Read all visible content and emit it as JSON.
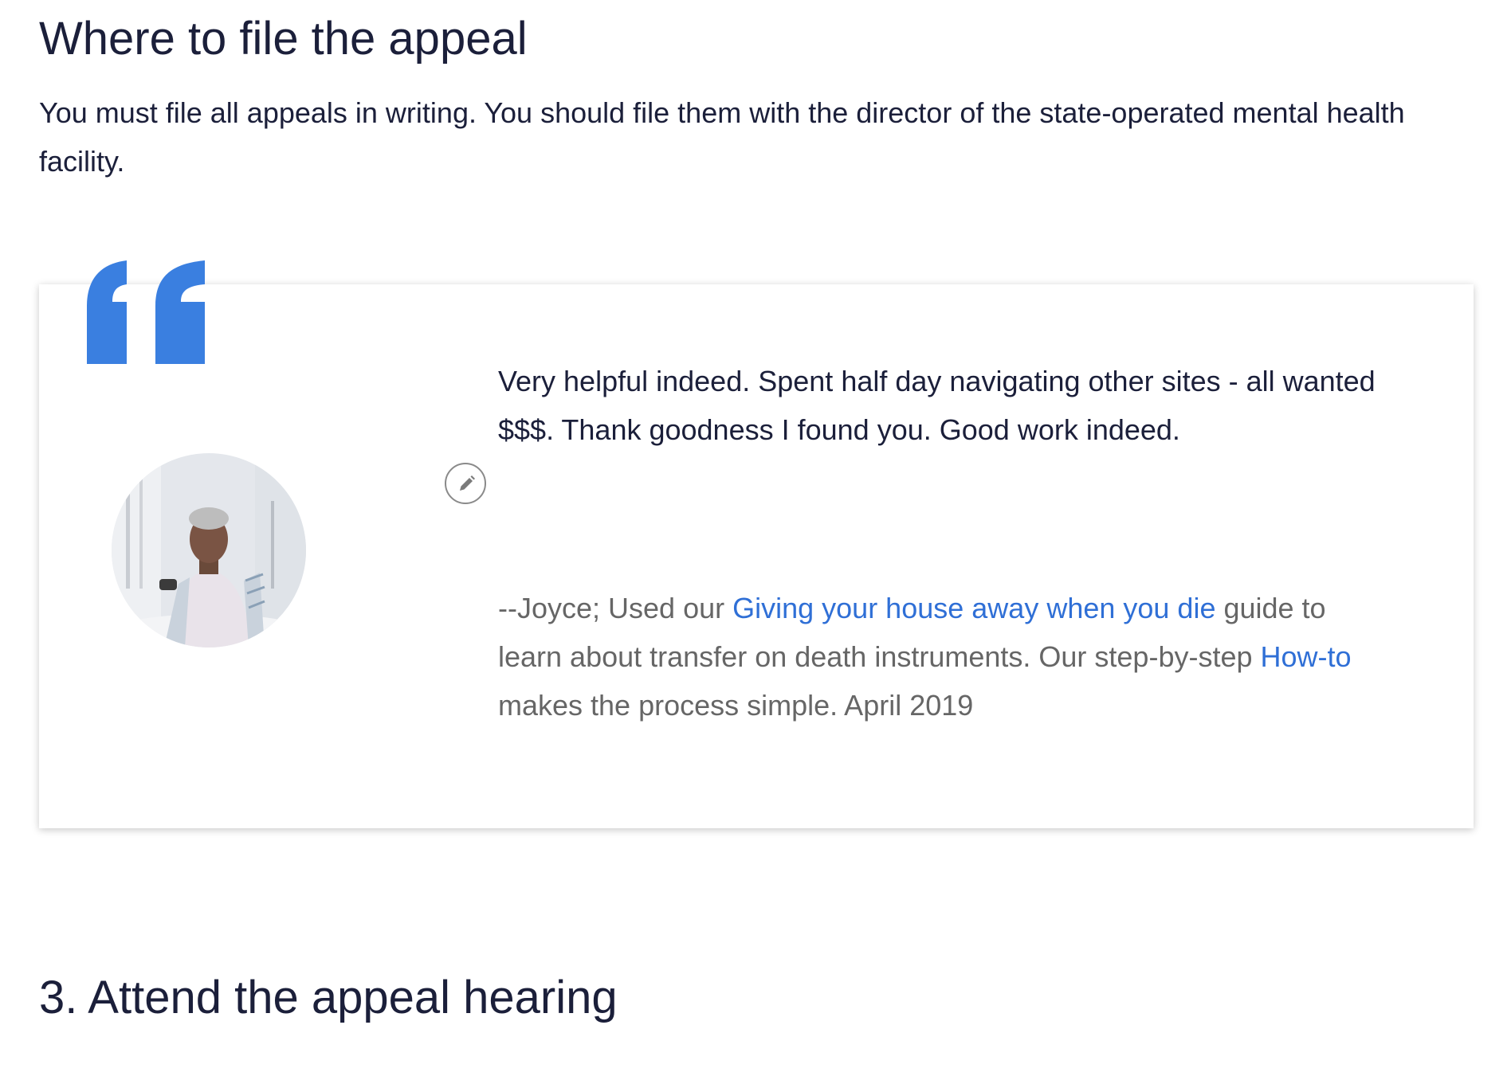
{
  "section": {
    "heading": "Where to file the appeal",
    "paragraph": "You must file all appeals in writing. You should file them with the director of the state-operated mental health facility."
  },
  "testimonial": {
    "quote_icon": "quote-icon",
    "edit_icon": "pencil-icon",
    "accent_color": "#3a7fe0",
    "quote": "Very helpful indeed. Spent half day navigating other sites - all wanted $$$. Thank goodness I found you. Good work indeed.",
    "attribution": {
      "prefix": "--Joyce; Used our ",
      "guide_link": "Giving your house away when you die",
      "middle": " guide to learn about transfer on death instruments. Our step-by-step ",
      "howto_link": "How-to",
      "suffix": " makes the process simple. April 2019"
    }
  },
  "next_step": {
    "heading": "3. Attend the appeal hearing"
  }
}
